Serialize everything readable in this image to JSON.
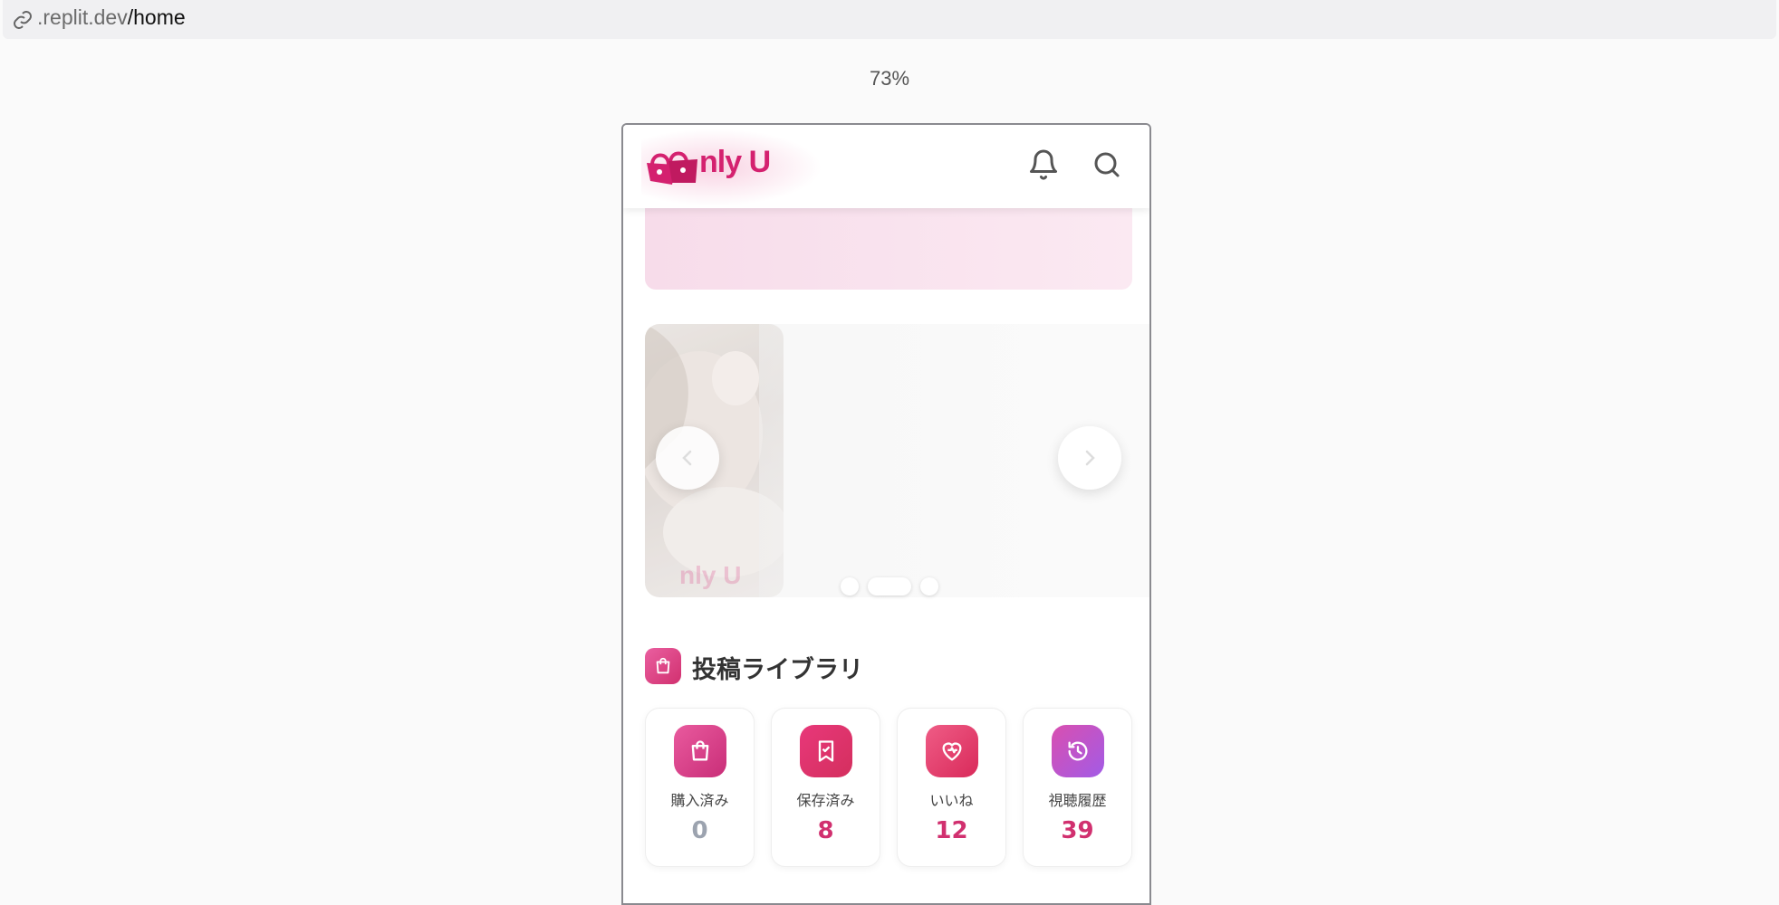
{
  "browser": {
    "url_host": ".replit.dev",
    "url_path": "/home",
    "zoom": "73%"
  },
  "header": {
    "logo_text": "nly U",
    "bell_icon": "bell-icon",
    "search_icon": "search-icon"
  },
  "carousel": {
    "prev_icon": "chevron-left-icon",
    "next_icon": "chevron-right-icon",
    "slide_count": 3,
    "active_slide": 2,
    "watermark": "nly U"
  },
  "library": {
    "title": "投稿ライブラリ",
    "icon": "shopping-bag-icon",
    "stats": [
      {
        "label": "購入済み",
        "value": "0",
        "icon": "shopping-bag-icon",
        "color": "#9ca3af"
      },
      {
        "label": "保存済み",
        "value": "8",
        "icon": "bookmark-icon",
        "color": "#d1306f"
      },
      {
        "label": "いいね",
        "value": "12",
        "icon": "heart-icon",
        "color": "#d1306f"
      },
      {
        "label": "視聴履歴",
        "value": "39",
        "icon": "history-icon",
        "color": "#d1306f"
      }
    ]
  },
  "colors": {
    "brand": "#d4216f",
    "accent_purple": "#b457e0"
  }
}
